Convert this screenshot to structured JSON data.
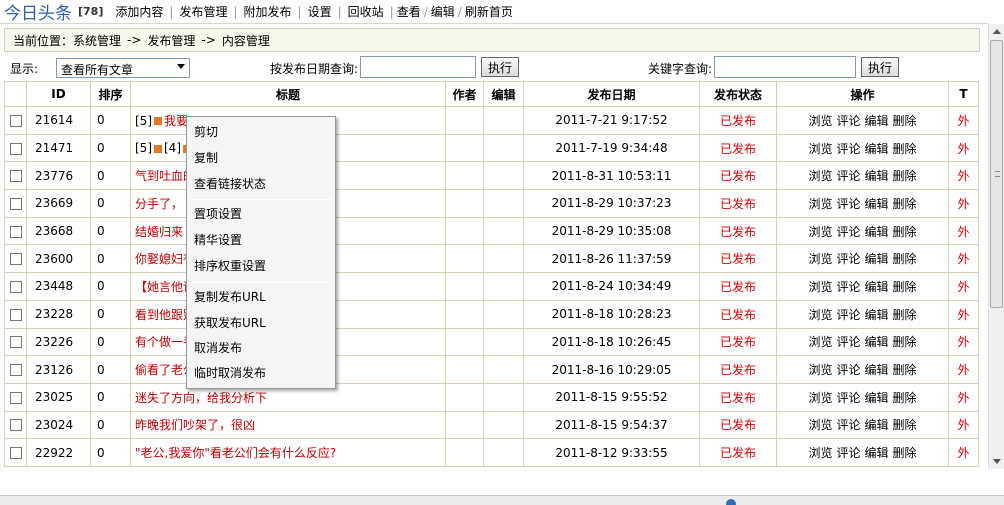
{
  "header": {
    "title": "今日头条",
    "count_badge": "[78]",
    "nav": [
      "添加内容",
      "发布管理",
      "附加发布",
      "设置",
      "回收站"
    ],
    "view_links": [
      "查看",
      "编辑",
      "刷新首页"
    ],
    "sep": "|",
    "slash": "/"
  },
  "breadcrumb": {
    "label": "当前位置：",
    "items": [
      "系统管理",
      "发布管理",
      "内容管理"
    ],
    "arrow": "->"
  },
  "filters": {
    "show_label": "显示:",
    "show_value": "查看所有文章",
    "date_label": "按发布日期查询:",
    "date_value": "",
    "date_button": "执行",
    "keyword_label": "关键字查询:",
    "keyword_value": "",
    "keyword_button": "执行"
  },
  "table": {
    "headers": [
      "",
      "ID",
      "排序",
      "标题",
      "作者",
      "编辑",
      "发布日期",
      "发布状态",
      "操作",
      "T"
    ],
    "ops": [
      "浏览",
      "评论",
      "编辑",
      "删除"
    ],
    "rows": [
      {
        "id": "21614",
        "order": "0",
        "title": "我要",
        "prefix": "[5]",
        "date": "2011-7-21 9:17:52",
        "status": "已发布",
        "t": "外"
      },
      {
        "id": "21471",
        "order": "0",
        "title": "",
        "prefix": "[5] [4]",
        "date": "2011-7-19 9:34:48",
        "status": "已发布",
        "t": "外"
      },
      {
        "id": "23776",
        "order": "0",
        "title": "气到吐血的",
        "prefix": "",
        "date": "2011-8-31 10:53:11",
        "status": "已发布",
        "t": "外"
      },
      {
        "id": "23669",
        "order": "0",
        "title": "分手了，",
        "prefix": "",
        "date": "2011-8-29 10:37:23",
        "status": "已发布",
        "t": "外"
      },
      {
        "id": "23668",
        "order": "0",
        "title": "结婚归来",
        "prefix": "",
        "date": "2011-8-29 10:35:08",
        "status": "已发布",
        "t": "外"
      },
      {
        "id": "23600",
        "order": "0",
        "title": "你娶媳妇有",
        "prefix": "",
        "date": "2011-8-26 11:37:59",
        "status": "已发布",
        "t": "外"
      },
      {
        "id": "23448",
        "order": "0",
        "title": "【她言他语",
        "prefix": "",
        "date": "2011-8-24 10:34:49",
        "status": "已发布",
        "t": "外"
      },
      {
        "id": "23228",
        "order": "0",
        "title": "看到他跟别",
        "prefix": "",
        "date": "2011-8-18 10:28:23",
        "status": "已发布",
        "t": "外"
      },
      {
        "id": "23226",
        "order": "0",
        "title": "有个做一手",
        "prefix": "",
        "date": "2011-8-18 10:26:45",
        "status": "已发布",
        "t": "外"
      },
      {
        "id": "23126",
        "order": "0",
        "title": "偷看了老公",
        "prefix": "",
        "date": "2011-8-16 10:29:05",
        "status": "已发布",
        "t": "外"
      },
      {
        "id": "23025",
        "order": "0",
        "title": "迷失了方向，给我分析下",
        "prefix": "",
        "date": "2011-8-15 9:55:52",
        "status": "已发布",
        "t": "外"
      },
      {
        "id": "23024",
        "order": "0",
        "title": "昨晚我们吵架了，很凶",
        "prefix": "",
        "date": "2011-8-15 9:54:37",
        "status": "已发布",
        "t": "外"
      },
      {
        "id": "22922",
        "order": "0",
        "title": "\"老公,我爱你\"看老公们会有什么反应?",
        "prefix": "",
        "date": "2011-8-12 9:33:55",
        "status": "已发布",
        "t": "外"
      }
    ]
  },
  "context_menu": {
    "groups": [
      [
        "剪切",
        "复制",
        "查看链接状态"
      ],
      [
        "置项设置",
        "精华设置",
        "排序权重设置"
      ],
      [
        "复制发布URL",
        "获取发布URL",
        "取消发布",
        "临时取消发布"
      ]
    ]
  },
  "colors": {
    "title_blue": "#2c5ea8",
    "status_red": "#e00000",
    "title_red": "#c00000",
    "border": "#d8d0b0"
  }
}
